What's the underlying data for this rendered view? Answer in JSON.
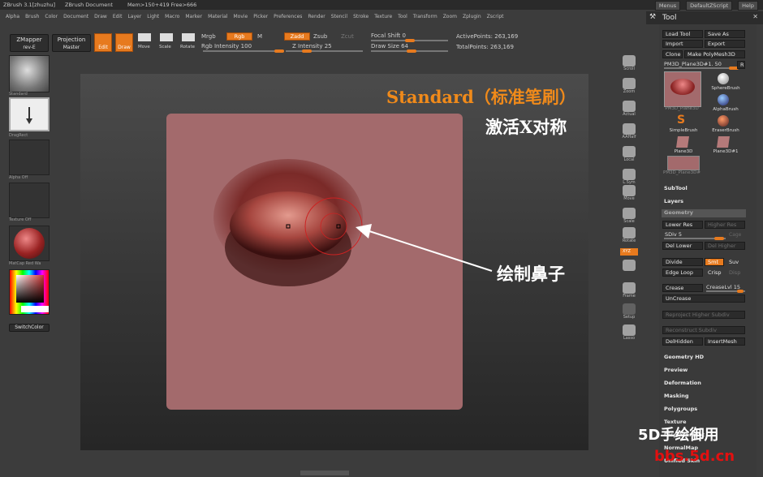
{
  "titlebar": {
    "app": "ZBrush 3.1[zhuzhu]",
    "document": "ZBrush Document",
    "mem": "Mem>150+419 Free>666",
    "menus_btn": "Menus",
    "script_btn": "DefaultZScript",
    "help_btn": "Help"
  },
  "menubar": [
    "Alpha",
    "Brush",
    "Color",
    "Document",
    "Draw",
    "Edit",
    "Layer",
    "Light",
    "Macro",
    "Marker",
    "Material",
    "Movie",
    "Picker",
    "Preferences",
    "Render",
    "Stencil",
    "Stroke",
    "Texture",
    "Tool",
    "Transform",
    "Zoom",
    "Zplugin",
    "Zscript"
  ],
  "top": {
    "zmapper": "ZMapper",
    "zmapper_sub": "rev-E",
    "projection": "Projection",
    "projection_sub": "Master",
    "edit": "Edit",
    "draw": "Draw",
    "move": "Move",
    "scale": "Scale",
    "rotate": "Rotate",
    "mrgb": "Mrgb",
    "rgb": "Rgb",
    "m": "M",
    "rgb_intensity": "Rgb Intensity 100",
    "zadd": "Zadd",
    "zsub": "Zsub",
    "zcut": "Zcut",
    "z_intensity": "Z Intensity 25",
    "focal_shift": "Focal Shift 0",
    "draw_size": "Draw Size 64",
    "active_points": "ActivePoints: 263,169",
    "total_points": "TotalPoints: 263,169"
  },
  "left": {
    "standard": "Standard",
    "dragrect": "DragRect",
    "alpha": "Alpha  Off",
    "texture": "Texture  Off",
    "matcap": "MatCap Red Wa",
    "switchcolor": "SwitchColor"
  },
  "rightstrip": [
    "Scroll",
    "Zoom",
    "Actual",
    "AAHalf",
    "Local",
    "L.Sym",
    "Move",
    "Scale",
    "Rotate",
    "XYZ",
    "",
    "Frame",
    "Setup",
    "Lasso"
  ],
  "tool": {
    "title": "Tool",
    "load_tool": "Load Tool",
    "save_as": "Save As",
    "import": "Import",
    "export": "Export",
    "clone": "Clone",
    "make_polymesh": "Make PolyMesh3D",
    "current": "PM3D_Plane3D#1. 50",
    "r": "R",
    "thumbs": [
      "PM3D_Plane3D",
      "SphereBrush",
      "AlphaBrush",
      "SimpleBrush",
      "EraserBrush",
      "Plane3D",
      "Plane3D#1",
      "PM3D_Plane3D#"
    ],
    "subtool": "SubTool",
    "layers": "Layers",
    "geometry": "Geometry",
    "lower_res": "Lower Res",
    "higher_res": "Higher Res",
    "sdiv": "SDiv 5",
    "cage": "Cage",
    "del_lower": "Del Lower",
    "del_higher": "Del Higher",
    "divide": "Divide",
    "smt": "Smt",
    "suv": "Suv",
    "edge_loop": "Edge Loop",
    "crisp": "Crisp",
    "disp": "Disp",
    "crease": "Crease",
    "creaselvl": "CreaseLvl 15",
    "uncrease": "UnCrease",
    "reproject": "Reproject Higher Subdiv",
    "reconstruct": "Reconstruct Subdiv",
    "delhidden": "DelHidden",
    "insertmesh": "InsertMesh",
    "sections": [
      "Geometry HD",
      "Preview",
      "Deformation",
      "Masking",
      "Polygroups",
      "Texture",
      "Displacement",
      "NormalMap",
      "Unified Skin"
    ]
  },
  "annotations": {
    "brush_name": "Standard（标准笔刷）",
    "activate": "激活X对称",
    "draw_nose": "绘制鼻子",
    "watermark1": "5D手绘御用",
    "watermark2": "bbs.5d.cn"
  },
  "colors": {
    "accent": "#e77a1e",
    "canvas": "#a36a6c"
  }
}
